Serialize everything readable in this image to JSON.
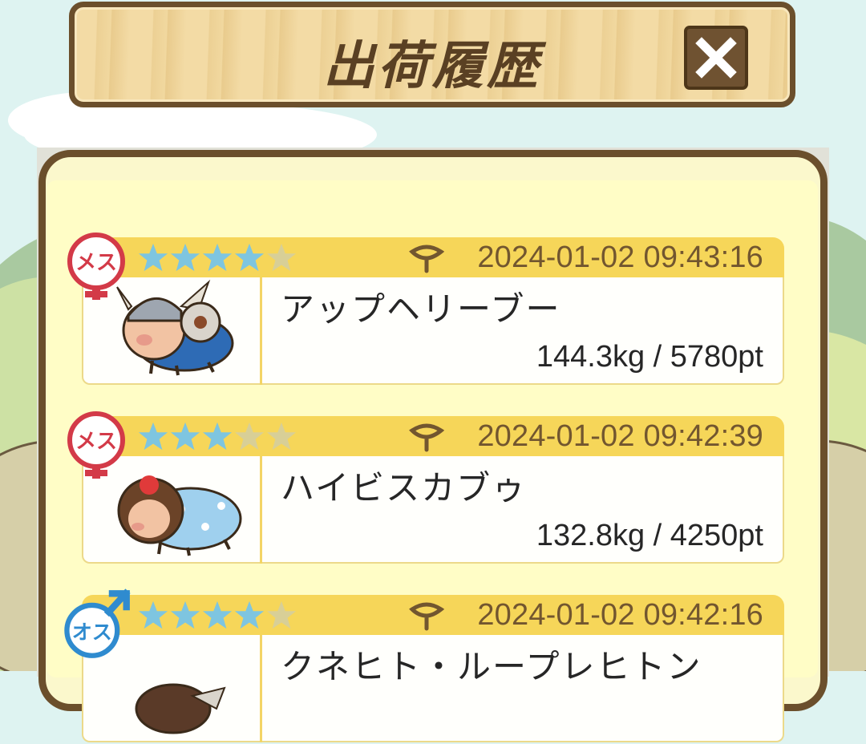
{
  "header": {
    "title": "出荷履歴"
  },
  "colors": {
    "wood_border": "#6b4f2c",
    "row_header": "#f6d659",
    "star_filled": "#7ec5e0",
    "star_empty": "#d8cf97",
    "female": "#d33a48",
    "male": "#2f8bcf"
  },
  "records": [
    {
      "gender": "メス",
      "gender_symbol": "female-symbol-icon",
      "stars": 4,
      "max_stars": 5,
      "date": "2024-01-02 09:43:16",
      "name": "アップヘリーブー",
      "stats": "144.3kg / 5780pt",
      "pig_icon": "viking-pig-icon"
    },
    {
      "gender": "メス",
      "gender_symbol": "female-symbol-icon",
      "stars": 3,
      "max_stars": 5,
      "date": "2024-01-02 09:42:39",
      "name": "ハイビスカブゥ",
      "stats": "132.8kg / 4250pt",
      "pig_icon": "hibiscus-pig-icon"
    },
    {
      "gender": "オス",
      "gender_symbol": "male-symbol-icon",
      "stars": 4,
      "max_stars": 5,
      "date": "2024-01-02 09:42:16",
      "name": "クネヒト・ループレヒトン",
      "stats": "",
      "pig_icon": "dark-pig-icon"
    }
  ]
}
